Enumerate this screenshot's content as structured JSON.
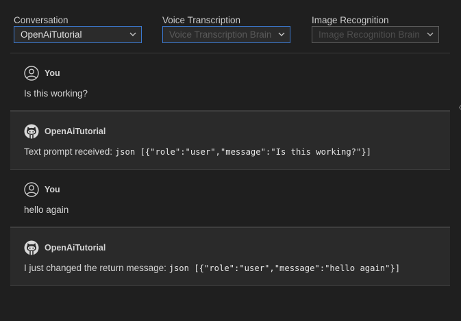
{
  "selectors": {
    "conversation": {
      "label": "Conversation",
      "value": "OpenAiTutorial"
    },
    "voice": {
      "label": "Voice Transcription",
      "placeholder": "Voice Transcription Brain"
    },
    "image": {
      "label": "Image Recognition",
      "placeholder": "Image Recognition Brain"
    }
  },
  "messages": [
    {
      "author": "You",
      "text": "Is this working?",
      "code": ""
    },
    {
      "author": "OpenAiTutorial",
      "text": "Text prompt received: ",
      "code": "json [{\"role\":\"user\",\"message\":\"Is this working?\"}]"
    },
    {
      "author": "You",
      "text": "hello again",
      "code": ""
    },
    {
      "author": "OpenAiTutorial",
      "text": "I just changed the return message: ",
      "code": "json [{\"role\":\"user\",\"message\":\"hello again\"}]"
    }
  ],
  "colors": {
    "background": "#1f1f1f",
    "bot_bubble": "#2a2a2a",
    "focus_border": "#3b79d1",
    "text": "#cccccc"
  },
  "icons": {
    "user_avatar": "user-circle-icon",
    "bot_avatar": "github-octocat-icon",
    "dropdown": "chevron-down-icon"
  }
}
